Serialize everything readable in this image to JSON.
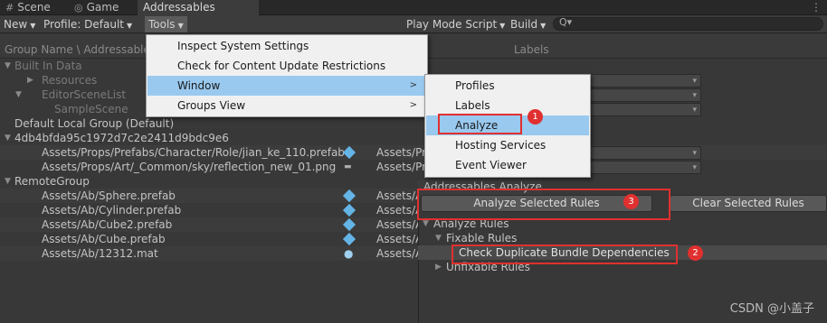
{
  "tabs": [
    {
      "icon": "#",
      "label": "Scene"
    },
    {
      "icon": "◎",
      "label": "Game"
    },
    {
      "icon": "",
      "label": "Addressables Groups"
    }
  ],
  "toolbar": {
    "new_label": "New",
    "profile_label": "Profile: Default",
    "tools_label": "Tools",
    "play_mode_label": "Play Mode Script",
    "build_label": "Build",
    "search_icon": "Q▾"
  },
  "columns": {
    "group_name": "Group Name \\ Addressable N",
    "labels": "Labels"
  },
  "tree": {
    "built_in": "Built In Data",
    "resources": "Resources",
    "editor_scene_list": "EditorSceneList",
    "sample_scene": "SampleScene",
    "default_local": "Default Local Group (Default)",
    "hash_group": "4db4bfda95c1972d7c2e2411d9bdc9e6",
    "hash_items": [
      {
        "name": "Assets/Props/Prefabs/Character/Role/jian_ke_110.prefab",
        "path": "Assets/Pr"
      },
      {
        "name": "Assets/Props/Art/_Common/sky/reflection_new_01.png",
        "path": "Assets/Pr"
      }
    ],
    "remote_group": "RemoteGroup",
    "remote_items": [
      {
        "name": "Assets/Ab/Sphere.prefab",
        "path": "Assets/A"
      },
      {
        "name": "Assets/Ab/Cylinder.prefab",
        "path": "Assets/A"
      },
      {
        "name": "Assets/Ab/Cube2.prefab",
        "path": "Assets/A"
      },
      {
        "name": "Assets/Ab/Cube.prefab",
        "path": "Assets/A"
      },
      {
        "name": "Assets/Ab/12312.mat",
        "path": "Assets/A"
      }
    ]
  },
  "tools_menu": [
    {
      "label": "Inspect System Settings",
      "submenu": false
    },
    {
      "label": "Check for Content Update Restrictions",
      "submenu": false
    },
    {
      "label": "Window",
      "submenu": true
    },
    {
      "label": "Groups View",
      "submenu": true
    }
  ],
  "window_menu": [
    "Profiles",
    "Labels",
    "Analyze",
    "Hosting Services",
    "Event Viewer"
  ],
  "analyze": {
    "title": "Addressables Analyze",
    "analyze_button": "Analyze Selected Rules",
    "clear_button": "Clear Selected Rules",
    "root": "Analyze Rules",
    "fixable": "Fixable Rules",
    "check_rule": "Check Duplicate Bundle Dependencies",
    "unfixable": "Unfixable Rules"
  },
  "badges": [
    "1",
    "2",
    "3"
  ],
  "watermark": "CSDN @小盖子",
  "colors": {
    "highlight": "#99c9ef",
    "annotation_red": "#e03030",
    "prefab_icon": "#64b4e6"
  }
}
